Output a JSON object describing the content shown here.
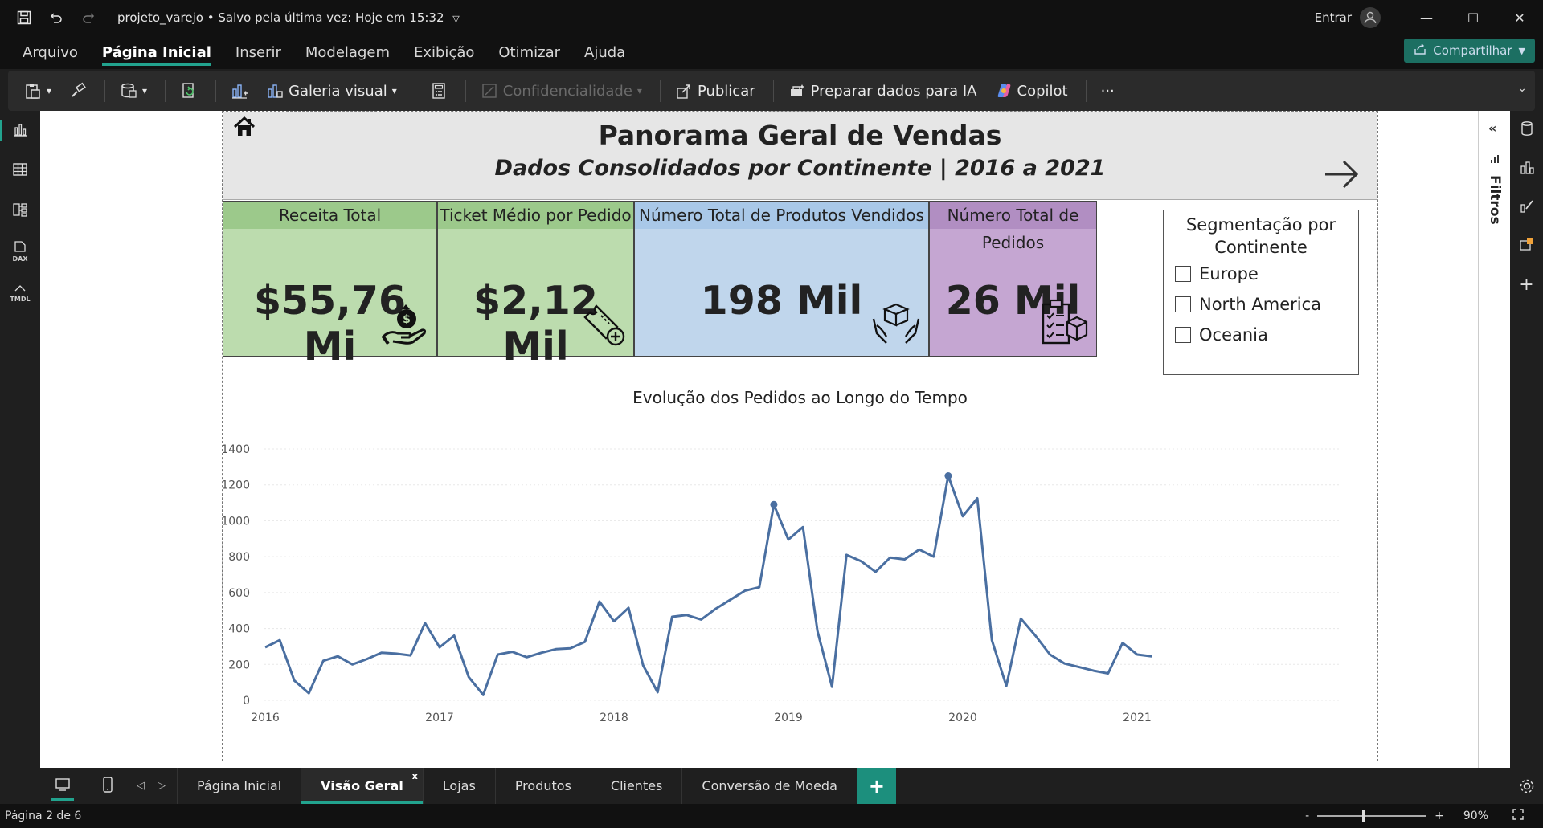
{
  "titlebar": {
    "doc_name": "projeto_varejo",
    "save_status": "• Salvo pela última vez: Hoje em 15:32",
    "signin": "Entrar"
  },
  "menu": [
    {
      "label": "Arquivo"
    },
    {
      "label": "Página Inicial",
      "active": true
    },
    {
      "label": "Inserir"
    },
    {
      "label": "Modelagem"
    },
    {
      "label": "Exibição"
    },
    {
      "label": "Otimizar"
    },
    {
      "label": "Ajuda"
    }
  ],
  "share_label": "Compartilhar",
  "ribbon": {
    "galeria_visual": "Galeria visual",
    "confidencialidade": "Confidencialidade",
    "publicar": "Publicar",
    "preparar_dados": "Preparar dados para IA",
    "copilot": "Copilot",
    "more": "···"
  },
  "left_rail": {
    "dax_label": "DAX",
    "tmdl_label": "TMDL"
  },
  "filters_label": "Filtros",
  "report": {
    "title": "Panorama Geral de Vendas",
    "subtitle": "Dados Consolidados por Continente | 2016 a 2021",
    "kpis": [
      {
        "label": "Receita Total",
        "value": "$55,76 Mi",
        "color": "#bcdcae",
        "head_color": "#9cc98b"
      },
      {
        "label": "Ticket Médio por Pedido",
        "value": "$2,12 Mil",
        "color": "#bcdcae",
        "head_color": "#9cc98b"
      },
      {
        "label": "Número Total de Produtos Vendidos",
        "value": "198 Mil",
        "color": "#c0d6ec",
        "head_color": "#a9c8e8"
      },
      {
        "label": "Número Total de Pedidos",
        "value": "26 Mil",
        "color": "#c5a6d2",
        "head_color": "#b18ec2"
      }
    ],
    "slicer": {
      "title_line1": "Segmentação por",
      "title_line2": "Continente",
      "options": [
        "Europe",
        "North America",
        "Oceania"
      ]
    },
    "chart_title": "Evolução dos Pedidos ao Longo do Tempo"
  },
  "chart_data": {
    "type": "line",
    "title": "Evolução dos Pedidos ao Longo do Tempo",
    "xlabel": "",
    "ylabel": "",
    "ylim": [
      0,
      1400
    ],
    "yticks": [
      0,
      200,
      400,
      600,
      800,
      1000,
      1200,
      1400
    ],
    "xticks": [
      "2016",
      "2017",
      "2018",
      "2019",
      "2020",
      "2021"
    ],
    "x": [
      "2016-01",
      "2016-02",
      "2016-03",
      "2016-04",
      "2016-05",
      "2016-06",
      "2016-07",
      "2016-08",
      "2016-09",
      "2016-10",
      "2016-11",
      "2016-12",
      "2017-01",
      "2017-02",
      "2017-03",
      "2017-04",
      "2017-05",
      "2017-06",
      "2017-07",
      "2017-08",
      "2017-09",
      "2017-10",
      "2017-11",
      "2017-12",
      "2018-01",
      "2018-02",
      "2018-03",
      "2018-04",
      "2018-05",
      "2018-06",
      "2018-07",
      "2018-08",
      "2018-09",
      "2018-10",
      "2018-11",
      "2018-12",
      "2019-01",
      "2019-02",
      "2019-03",
      "2019-04",
      "2019-05",
      "2019-06",
      "2019-07",
      "2019-08",
      "2019-09",
      "2019-10",
      "2019-11",
      "2019-12",
      "2020-01",
      "2020-02",
      "2020-03",
      "2020-04",
      "2020-05",
      "2020-06",
      "2020-07",
      "2020-08",
      "2020-09",
      "2020-10",
      "2020-11",
      "2020-12",
      "2021-01",
      "2021-02"
    ],
    "series": [
      {
        "values": [
          295,
          335,
          110,
          40,
          220,
          245,
          200,
          230,
          265,
          260,
          250,
          430,
          295,
          360,
          130,
          30,
          255,
          270,
          240,
          265,
          285,
          290,
          325,
          550,
          440,
          515,
          195,
          45,
          465,
          475,
          450,
          510,
          560,
          610,
          630,
          1090,
          895,
          965,
          385,
          75,
          810,
          775,
          715,
          795,
          785,
          840,
          800,
          1250,
          1025,
          1125,
          335,
          80,
          455,
          360,
          255,
          205,
          185,
          165,
          150,
          320,
          255,
          245
        ],
        "color": "#4a6fa1"
      }
    ],
    "grid": true,
    "markers_at": [
      "2018-12",
      "2019-12"
    ]
  },
  "tabs": [
    {
      "label": "Página Inicial"
    },
    {
      "label": "Visão Geral",
      "active": true
    },
    {
      "label": "Lojas"
    },
    {
      "label": "Produtos"
    },
    {
      "label": "Clientes"
    },
    {
      "label": "Conversão de Moeda"
    }
  ],
  "status": {
    "page": "Página 2 de 6",
    "zoom": "90%"
  }
}
